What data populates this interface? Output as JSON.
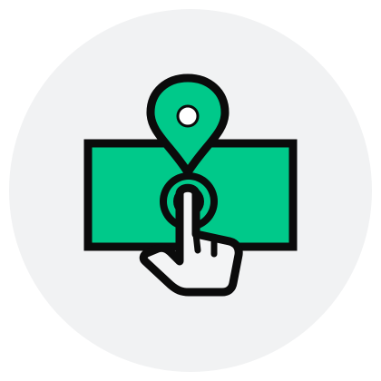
{
  "icon": {
    "name": "map-pin-tap-icon",
    "colors": {
      "background_circle": "#f1f2f3",
      "accent_green": "#00c98a",
      "outline": "#0b0b0b",
      "hand_fill": "#f3f4f5",
      "pin_dot": "#ffffff"
    }
  }
}
